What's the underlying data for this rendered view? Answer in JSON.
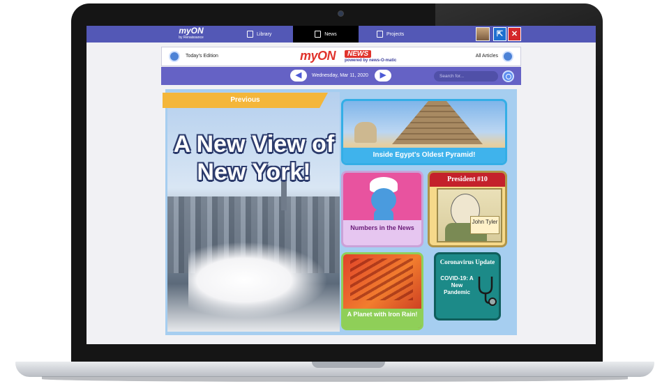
{
  "topnav": {
    "logo": "myON",
    "logo_sub": "by Renaissance",
    "tabs": [
      {
        "label": "Library",
        "icon": "book-icon"
      },
      {
        "label": "News",
        "icon": "newspaper-icon",
        "active": true
      },
      {
        "label": "Projects",
        "icon": "folder-icon"
      }
    ]
  },
  "masthead": {
    "today_label": "Today's Edition",
    "brand": "myON",
    "brand_news": "NEWS",
    "brand_sub": "powered by news-O-matic",
    "all_articles_label": "All Articles"
  },
  "datebar": {
    "date": "Wednesday, Mar 11, 2020",
    "search_placeholder": "Search for..."
  },
  "hero": {
    "banner": "Previous",
    "title": "A New View of New York!"
  },
  "cards": {
    "pyramid": "Inside Egypt's Oldest Pyramid!",
    "smurf": "Numbers in the News",
    "tyler_ribbon": "President #10",
    "tyler_name": "John Tyler",
    "planet": "A Planet with Iron Rain!",
    "covid_title": "Coronavirus Update",
    "covid_text": "COVID-19: A New Pandemic"
  },
  "colors": {
    "nav": "#5358b6",
    "datebar": "#6562c5",
    "brand_red": "#e0332c",
    "banner": "#f4b63a"
  }
}
